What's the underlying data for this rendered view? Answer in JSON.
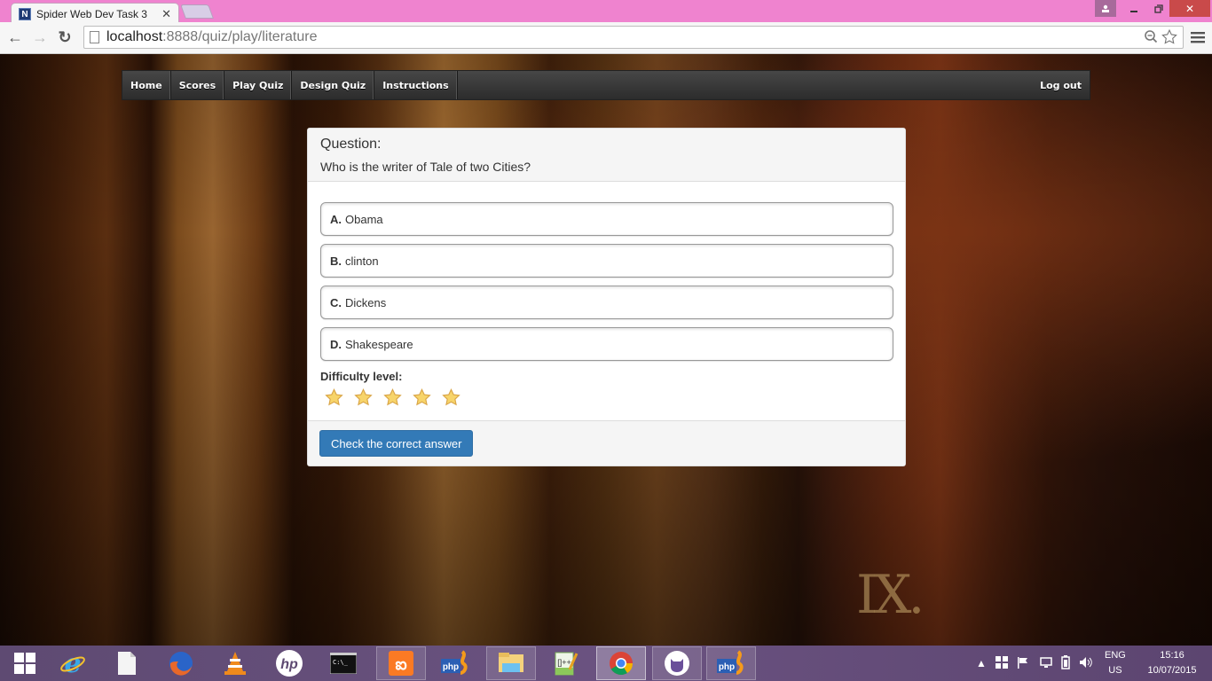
{
  "browser": {
    "tab_title": "Spider Web Dev Task 3",
    "tab_favicon": "N",
    "url_host": "localhost",
    "url_rest": ":8888/quiz/play/literature",
    "icons": {
      "back": "arrow-left-icon",
      "forward": "arrow-right-icon",
      "reload": "reload-icon",
      "zoom": "zoom-icon",
      "bookmark": "star-outline-icon",
      "menu": "hamburger-menu-icon"
    }
  },
  "nav": {
    "items": [
      {
        "label": "Home"
      },
      {
        "label": "Scores"
      },
      {
        "label": "Play Quiz"
      },
      {
        "label": "Design Quiz"
      },
      {
        "label": "Instructions"
      }
    ],
    "logout_label": "Log out"
  },
  "quiz": {
    "question_label": "Question:",
    "question_text": "Who is the writer of Tale of two Cities?",
    "options": [
      {
        "letter": "A.",
        "text": "Obama"
      },
      {
        "letter": "B.",
        "text": "clinton"
      },
      {
        "letter": "C.",
        "text": "Dickens"
      },
      {
        "letter": "D.",
        "text": "Shakespeare"
      }
    ],
    "difficulty_label": "Difficulty level:",
    "difficulty_rating": 5,
    "difficulty_max": 5,
    "check_button_label": "Check the correct answer",
    "accent_color": "#337ab7"
  },
  "background": {
    "roman_numeral": "IX."
  },
  "taskbar": {
    "apps": [
      {
        "name": "start",
        "icon": "windows-logo-icon"
      },
      {
        "name": "internet-explorer",
        "icon": "ie-icon"
      },
      {
        "name": "file",
        "icon": "blank-document-icon"
      },
      {
        "name": "firefox",
        "icon": "firefox-icon"
      },
      {
        "name": "vlc",
        "icon": "vlc-cone-icon"
      },
      {
        "name": "hp",
        "icon": "hp-logo-icon"
      },
      {
        "name": "command-prompt",
        "icon": "cmd-icon"
      },
      {
        "name": "xampp",
        "icon": "xampp-icon"
      },
      {
        "name": "phpstorm",
        "icon": "phpstorm-icon"
      },
      {
        "name": "file-explorer",
        "icon": "folder-icon"
      },
      {
        "name": "notepad-plus-plus",
        "icon": "notepadpp-icon"
      },
      {
        "name": "chrome",
        "icon": "chrome-icon"
      },
      {
        "name": "github",
        "icon": "github-cat-icon"
      },
      {
        "name": "phpstorm-2",
        "icon": "phpstorm-icon"
      }
    ],
    "lang_top": "ENG",
    "lang_bottom": "US",
    "time": "15:16",
    "date": "10/07/2015"
  }
}
